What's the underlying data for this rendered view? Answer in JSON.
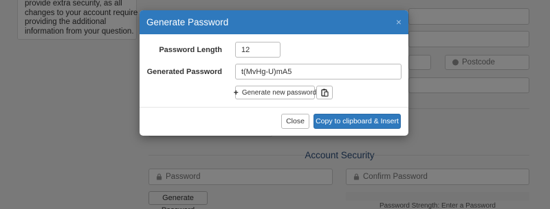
{
  "background": {
    "note_lines": [
      "provide extra security, as all",
      "changes to your account require",
      "providing the additional",
      "information from your question."
    ],
    "postcode_placeholder": "Postcode",
    "section_title": "Account Security",
    "password_placeholder": "Password",
    "confirm_password_placeholder": "Confirm Password",
    "generate_password_button": "Generate Password",
    "strength_text": "Password Strength: Enter a Password"
  },
  "modal": {
    "title": "Generate Password",
    "close_icon": "×",
    "length_label": "Password Length",
    "length_value": "12",
    "generated_label": "Generated Password",
    "generated_value": "t(MvHg-U)mA5",
    "generate_new_label": "Generate new password",
    "copy_icon": "clipboard-icon",
    "close_button": "Close",
    "insert_button": "Copy to clipboard & Insert"
  },
  "colors": {
    "modal_header": "#2f79bd",
    "primary_button": "#2f79bd",
    "section_title": "#2a4d7a"
  }
}
